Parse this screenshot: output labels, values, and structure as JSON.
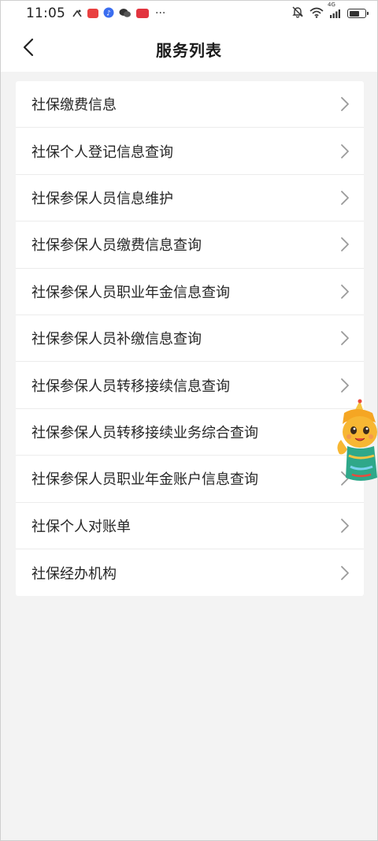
{
  "status_bar": {
    "time": "11:05",
    "network_label": "4G",
    "battery_level": 0.7,
    "app_icons": [
      {
        "name": "notification-app-icon",
        "color": "#d94c3d"
      },
      {
        "name": "app-red-icon",
        "color": "#e94040"
      },
      {
        "name": "app-blue-icon",
        "color": "#3a6df0"
      },
      {
        "name": "wechat-icon",
        "color": "#333333"
      },
      {
        "name": "app-red-badge-icon",
        "color": "#e2343f"
      }
    ],
    "more_indicator": "···"
  },
  "header": {
    "title": "服务列表",
    "back_icon": "chevron-left-icon"
  },
  "services": [
    {
      "label": "社保缴费信息",
      "show_chevron": true
    },
    {
      "label": "社保个人登记信息查询",
      "show_chevron": true
    },
    {
      "label": "社保参保人员信息维护",
      "show_chevron": true
    },
    {
      "label": "社保参保人员缴费信息查询",
      "show_chevron": true
    },
    {
      "label": "社保参保人员职业年金信息查询",
      "show_chevron": true
    },
    {
      "label": "社保参保人员补缴信息查询",
      "show_chevron": true
    },
    {
      "label": "社保参保人员转移接续信息查询",
      "show_chevron": true
    },
    {
      "label": "社保参保人员转移接续业务综合查询",
      "show_chevron": false
    },
    {
      "label": "社保参保人员职业年金账户信息查询",
      "show_chevron": true
    },
    {
      "label": "社保个人对账单",
      "show_chevron": true
    },
    {
      "label": "社保经办机构",
      "show_chevron": true
    }
  ],
  "colors": {
    "background": "#f3f3f3",
    "card": "#ffffff",
    "divider": "#ececec",
    "chevron": "#9a9a9a",
    "mascot_primary": "#f5a623"
  }
}
